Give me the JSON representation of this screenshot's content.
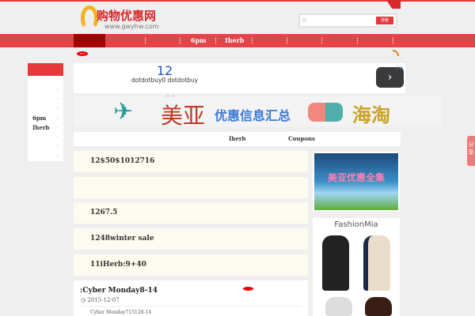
{
  "header": {
    "logo_text": "购物优惠网",
    "logo_url": "www.gwyhw.com",
    "search": {
      "placeholder": "",
      "button": "搜索"
    }
  },
  "nav": {
    "items": [
      "6pm",
      "Iherb"
    ]
  },
  "sidebar": {
    "items": [
      "",
      "",
      "",
      "",
      "6pm",
      "Iherb",
      "",
      "",
      ""
    ]
  },
  "ad": {
    "number": "12",
    "text": "dotdotbuy0 dotdotbuy",
    "next": "›"
  },
  "banner": {
    "text1": "美亚",
    "text2": "优惠信息汇总",
    "text3": "海淘"
  },
  "tabs": [
    "Iherb",
    "Coupons"
  ],
  "rows": [
    "12$50$1012716",
    "",
    "1267.5",
    "1248winter sale",
    "11iHerb:9+40"
  ],
  "post": {
    "title": ":Cyber Monday8-14",
    "date": "2015-12-07",
    "excerpt": "Cyber Monday715128-14"
  },
  "right": {
    "image_text": "美亚优惠全集",
    "ad_brand": "FashionMia"
  },
  "share": "分享"
}
